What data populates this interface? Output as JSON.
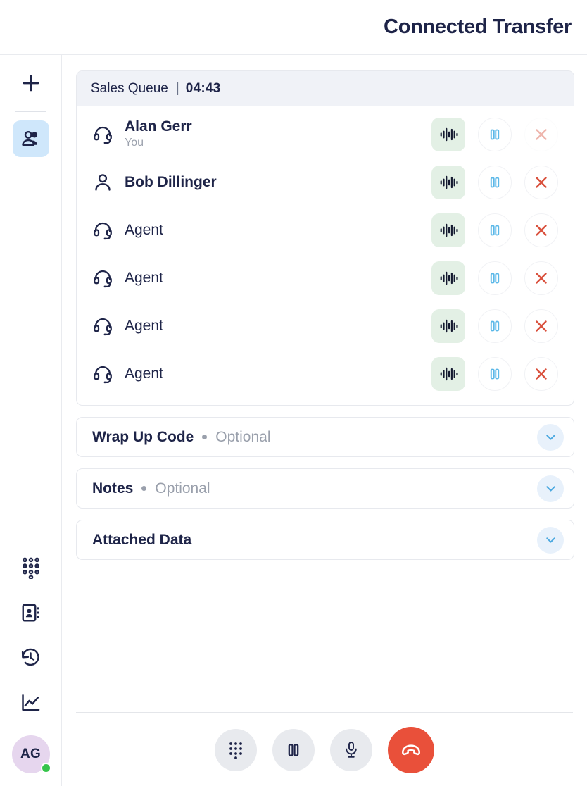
{
  "header": {
    "title": "Connected Transfer"
  },
  "sidebar": {
    "add_label": "plus-icon",
    "nav": [
      {
        "name": "contacts-people",
        "icon": "people-icon",
        "active": true
      }
    ],
    "lower": [
      {
        "name": "dialpad",
        "icon": "dialpad-icon"
      },
      {
        "name": "address-book",
        "icon": "address-book-icon"
      },
      {
        "name": "history",
        "icon": "history-icon"
      },
      {
        "name": "analytics",
        "icon": "line-chart-icon"
      }
    ],
    "user": {
      "initials": "AG",
      "status": "online"
    }
  },
  "call": {
    "queue_name": "Sales Queue",
    "separator": "|",
    "timer": "04:43",
    "participants": [
      {
        "name": "Alan Gerr",
        "subtitle": "You",
        "icon": "headset-icon",
        "bold": true,
        "wave_label": "waveform-icon",
        "hold_label": "pause-icon",
        "remove_label": "remove-icon",
        "remove_disabled": true
      },
      {
        "name": "Bob Dillinger",
        "subtitle": "",
        "icon": "person-icon",
        "bold": true,
        "wave_label": "waveform-icon",
        "hold_label": "pause-icon",
        "remove_label": "remove-icon",
        "remove_disabled": false
      },
      {
        "name": "Agent",
        "subtitle": "",
        "icon": "headset-icon",
        "bold": false,
        "wave_label": "waveform-icon",
        "hold_label": "pause-icon",
        "remove_label": "remove-icon",
        "remove_disabled": false
      },
      {
        "name": "Agent",
        "subtitle": "",
        "icon": "headset-icon",
        "bold": false,
        "wave_label": "waveform-icon",
        "hold_label": "pause-icon",
        "remove_label": "remove-icon",
        "remove_disabled": false
      },
      {
        "name": "Agent",
        "subtitle": "",
        "icon": "headset-icon",
        "bold": false,
        "wave_label": "waveform-icon",
        "hold_label": "pause-icon",
        "remove_label": "remove-icon",
        "remove_disabled": false
      },
      {
        "name": "Agent",
        "subtitle": "",
        "icon": "headset-icon",
        "bold": false,
        "wave_label": "waveform-icon",
        "hold_label": "pause-icon",
        "remove_label": "remove-icon",
        "remove_disabled": false
      }
    ]
  },
  "sections": [
    {
      "label": "Wrap Up Code",
      "optional": "Optional",
      "has_dot": true,
      "name": "wrap-up-code"
    },
    {
      "label": "Notes",
      "optional": "Optional",
      "has_dot": true,
      "name": "notes"
    },
    {
      "label": "Attached Data",
      "optional": "",
      "has_dot": false,
      "name": "attached-data"
    }
  ],
  "controls": [
    {
      "name": "dialpad",
      "icon": "dialpad-icon",
      "style": "normal"
    },
    {
      "name": "hold",
      "icon": "pause-icon",
      "style": "normal"
    },
    {
      "name": "mute",
      "icon": "microphone-icon",
      "style": "normal"
    },
    {
      "name": "end-call",
      "icon": "end-call-icon",
      "style": "end"
    }
  ],
  "colors": {
    "navy": "#1e2448",
    "red": "#e9503a",
    "blue": "#5bb8e8",
    "green_bg": "#e3f0e5",
    "active_nav": "#cfe7fb",
    "avatar_bg": "#e6d6ee",
    "status_green": "#35c44a"
  }
}
